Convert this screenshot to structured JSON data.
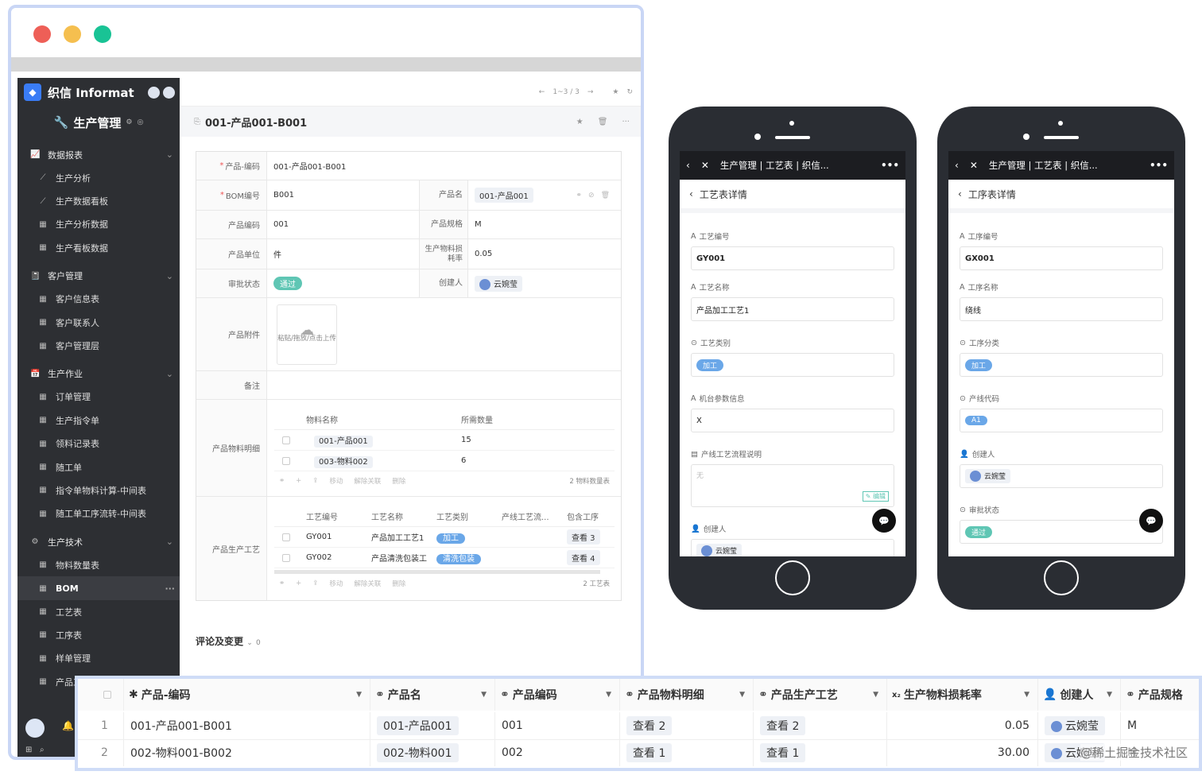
{
  "desktop": {
    "brand": "织信 Informat",
    "app_name": "生产管理",
    "pager": "1~3 / 3",
    "record_title": "001-产品001-B001",
    "sidebar": {
      "groups": [
        {
          "label": "数据报表",
          "items": [
            "生产分析",
            "生产数据看板",
            "生产分析数据",
            "生产看板数据"
          ]
        },
        {
          "label": "客户管理",
          "items": [
            "客户信息表",
            "客户联系人",
            "客户管理层"
          ]
        },
        {
          "label": "生产作业",
          "items": [
            "订单管理",
            "生产指令单",
            "领料记录表",
            "随工单",
            "指令单物料计算-中间表",
            "随工单工序流转-中间表"
          ]
        },
        {
          "label": "生产技术",
          "items": [
            "物料数量表",
            "BOM",
            "工艺表",
            "工序表",
            "样单管理",
            "产品工..."
          ]
        }
      ],
      "active_item": "BOM",
      "active_more": "···"
    },
    "form": {
      "product_code_label": "产品-编码",
      "product_code_value": "001-产品001-B001",
      "bom_label": "BOM编号",
      "bom_value": "B001",
      "product_name_label": "产品名",
      "product_name_value": "001-产品001",
      "code_label": "产品编码",
      "code_value": "001",
      "spec_label": "产品规格",
      "spec_value": "M",
      "unit_label": "产品单位",
      "unit_value": "件",
      "loss_label": "生产物料损耗率",
      "loss_value": "0.05",
      "approval_label": "审批状态",
      "approval_value": "通过",
      "creator_label": "创建人",
      "creator_value": "云婉莹",
      "attach_label": "产品附件",
      "upload_text": "粘贴/拖放/点击上传",
      "remark_label": "备注",
      "materials_label": "产品物料明细",
      "materials_headers": [
        "物料名称",
        "所需数量"
      ],
      "materials_rows": [
        {
          "name": "001-产品001",
          "qty": "15"
        },
        {
          "name": "003-物料002",
          "qty": "6"
        }
      ],
      "toolbar": [
        "移动",
        "解除关联",
        "删除"
      ],
      "materials_count": "2 物料数量表",
      "process_label": "产品生产工艺",
      "process_headers": [
        "工艺编号",
        "工艺名称",
        "工艺类别",
        "产线工艺流...",
        "包含工序"
      ],
      "process_rows": [
        {
          "no": "GY001",
          "name": "产品加工工艺1",
          "type": "加工",
          "view": "查看 3"
        },
        {
          "no": "GY002",
          "name": "产品清洗包装工",
          "type": "清洗包装",
          "view": "查看 4"
        }
      ],
      "process_count": "2 工艺表"
    },
    "comments": {
      "label": "评论及变更",
      "count": "0"
    }
  },
  "phone1": {
    "nav_title": "生产管理 | 工艺表 | 织信...",
    "page_title": "工艺表详情",
    "fields": [
      {
        "label": "工艺编号",
        "value": "GY001"
      },
      {
        "label": "工艺名称",
        "value": "产品加工工艺1"
      },
      {
        "label": "工艺类别",
        "value": "加工"
      },
      {
        "label": "机台参数信息",
        "value": "X"
      },
      {
        "label": "产线工艺流程说明",
        "value": "无"
      },
      {
        "label": "创建人",
        "value": "云婉莹"
      }
    ],
    "edit": "编辑"
  },
  "phone2": {
    "nav_title": "生产管理 | 工艺表 | 织信...",
    "page_title": "工序表详情",
    "fields": [
      {
        "label": "工序编号",
        "value": "GX001"
      },
      {
        "label": "工序名称",
        "value": "绕线"
      },
      {
        "label": "工序分类",
        "value": "加工"
      },
      {
        "label": "产线代码",
        "value": "A1"
      },
      {
        "label": "创建人",
        "value": "云婉莹"
      },
      {
        "label": "审批状态",
        "value": "通过"
      }
    ]
  },
  "grid": {
    "headers": [
      "产品-编码",
      "产品名",
      "产品编码",
      "产品物料明细",
      "产品生产工艺",
      "生产物料损耗率",
      "创建人",
      "产品规格"
    ],
    "rows": [
      {
        "idx": "1",
        "code": "001-产品001-B001",
        "name": "001-产品001",
        "pcode": "001",
        "mat": "查看 2",
        "proc": "查看 2",
        "loss": "0.05",
        "creator": "云婉莹",
        "spec": "M"
      },
      {
        "idx": "2",
        "code": "002-物料001-B002",
        "name": "002-物料001",
        "pcode": "002",
        "mat": "查看 1",
        "proc": "查看 1",
        "loss": "30.00",
        "creator": "云婉莹",
        "spec": "M"
      }
    ],
    "watermark": "@稀土掘金技术社区"
  }
}
